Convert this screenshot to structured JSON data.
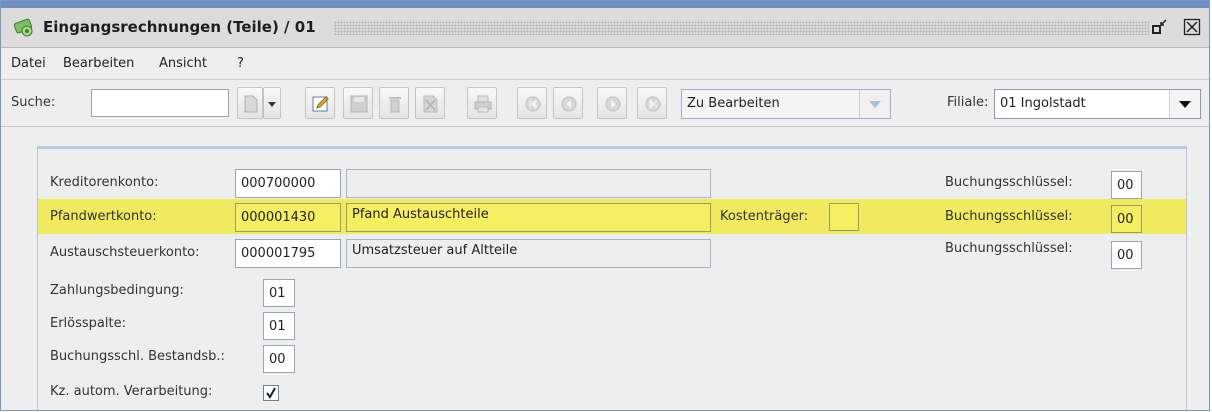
{
  "window": {
    "title": "Eingangsrechnungen (Teile)  / 01"
  },
  "menu": {
    "datei": "Datei",
    "bearbeiten": "Bearbeiten",
    "ansicht": "Ansicht",
    "help": "?"
  },
  "toolbar": {
    "search_label": "Suche:",
    "search_value": "",
    "status_combo": "Zu Bearbeiten",
    "filiale_label": "Filiale:",
    "filiale_value": "01 Ingolstadt"
  },
  "form": {
    "kreditorenkonto": {
      "label": "Kreditorenkonto:",
      "value": "000700000",
      "desc": ""
    },
    "pfandwertkonto": {
      "label": "Pfandwertkonto:",
      "value": "000001430",
      "desc": "Pfand Austauschteile"
    },
    "austauschsteuerkonto": {
      "label": "Austauschsteuerkonto:",
      "value": "000001795",
      "desc": "Umsatzsteuer auf Altteile"
    },
    "kostentraeger": {
      "label": "Kostenträger:",
      "value": ""
    },
    "buchungsschluessel_label": "Buchungsschlüssel:",
    "bs1": "00",
    "bs2": "00",
    "bs3": "00",
    "zahlungsbedingung": {
      "label": "Zahlungsbedingung:",
      "value": "01"
    },
    "erloesspalte": {
      "label": "Erlösspalte:",
      "value": "01"
    },
    "buchungsschl_bestand": {
      "label": "Buchungsschl. Bestandsb.:",
      "value": "00"
    },
    "kz_autom": {
      "label": "Kz. autom. Verarbeitung:",
      "checked": true
    }
  },
  "colors": {
    "highlight": "#f1ea5f",
    "title_accent": "#6f8fc2"
  }
}
